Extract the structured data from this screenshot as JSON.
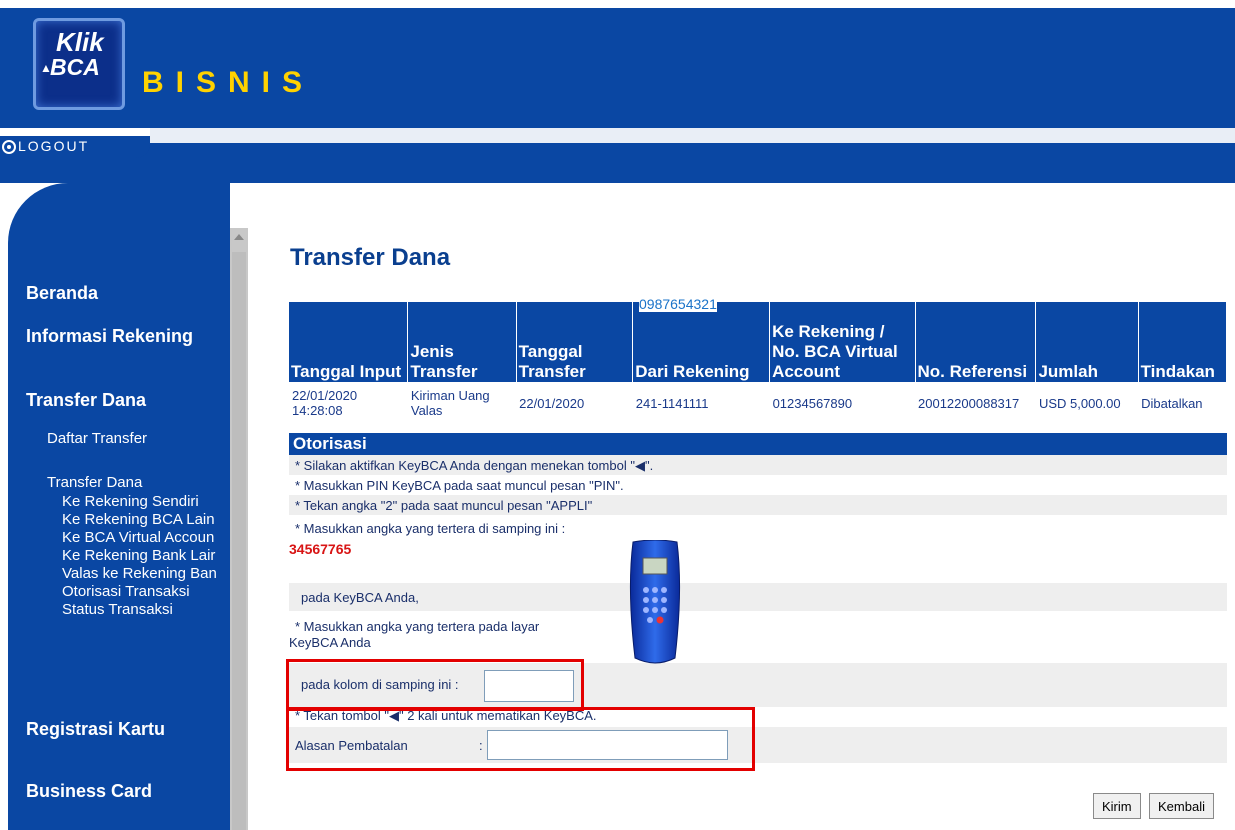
{
  "header": {
    "logo_line1": "Klik",
    "logo_line2": "BCA",
    "brand": "BISNIS",
    "logout_label": "LOGOUT"
  },
  "sidebar": {
    "beranda": "Beranda",
    "informasi_rekening": "Informasi Rekening",
    "transfer_dana": "Transfer Dana",
    "daftar_transfer": "Daftar Transfer",
    "transfer_dana_sub": "Transfer Dana",
    "items": [
      "Ke Rekening Sendiri",
      "Ke Rekening BCA Lain",
      "Ke BCA Virtual Accoun",
      "Ke Rekening Bank Lair",
      "Valas ke Rekening Ban",
      "Otorisasi Transaksi",
      "Status Transaksi"
    ],
    "registrasi_kartu": "Registrasi Kartu",
    "business_card": "Business Card"
  },
  "main": {
    "title": "Transfer Dana",
    "overlay_number": "0987654321",
    "table": {
      "headers": [
        "Tanggal Input",
        "Jenis Transfer",
        "Tanggal Transfer",
        "Dari Rekening",
        "Ke Rekening / No. BCA Virtual Account",
        "No. Referensi",
        "Jumlah",
        "Tindakan"
      ],
      "row": {
        "tanggal_input": "22/01/2020 14:28:08",
        "jenis_transfer": "Kiriman Uang Valas",
        "tanggal_transfer": "22/01/2020",
        "dari_rekening": "241-1141111",
        "ke_rekening": "01234567890",
        "no_referensi": "20012200088317",
        "jumlah": "USD 5,000.00",
        "tindakan": "Dibatalkan"
      }
    },
    "otorisasi": {
      "title": "Otorisasi",
      "line1": "* Silakan aktifkan KeyBCA Anda dengan menekan tombol \"",
      "line1_end": "\".",
      "line2": "* Masukkan PIN KeyBCA pada saat muncul pesan \"PIN\".",
      "line3": "* Tekan angka \"2\" pada saat muncul pesan \"APPLI\"",
      "line4": "* Masukkan angka yang tertera di samping ini :",
      "code": "34567765",
      "line5": "pada KeyBCA Anda,",
      "line6a": "* Masukkan angka yang tertera pada layar",
      "line6b": "KeyBCA Anda",
      "line7": "pada kolom di samping ini :",
      "line8": "* Tekan tombol \"",
      "line8_end": "\" 2 kali untuk mematikan KeyBCA.",
      "alasan_label": "Alasan Pembatalan",
      "colon": ":"
    },
    "buttons": {
      "kirim": "Kirim",
      "kembali": "Kembali"
    }
  },
  "colors": {
    "primary_blue": "#0a47a3",
    "brand_yellow": "#ffd200",
    "highlight_red": "#e30000",
    "code_red": "#d81414"
  }
}
